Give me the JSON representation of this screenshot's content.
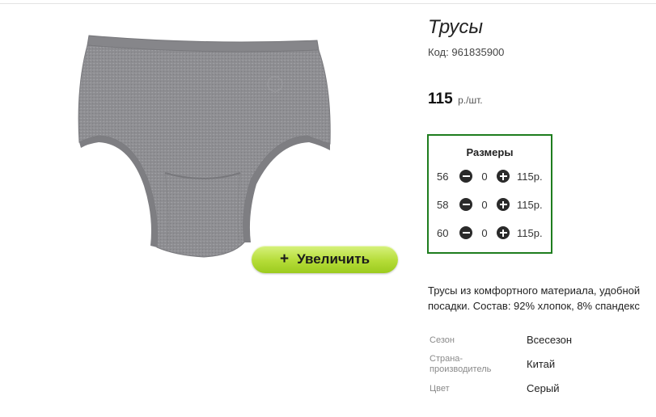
{
  "product": {
    "title": "Трусы",
    "code_label": "Код:",
    "code_value": "961835900",
    "price_value": "115",
    "price_unit": "р./шт.",
    "image_icon": "briefs-photo",
    "zoom_button": {
      "icon": "+",
      "label": "Увеличить"
    }
  },
  "sizes": {
    "title": "Размеры",
    "rows": [
      {
        "size": "56",
        "qty": "0",
        "price": "115р."
      },
      {
        "size": "58",
        "qty": "0",
        "price": "115р."
      },
      {
        "size": "60",
        "qty": "0",
        "price": "115р."
      }
    ],
    "minus_icon": "minus-circle-icon",
    "plus_icon": "plus-circle-icon",
    "border_color": "#1e7d1e"
  },
  "description": {
    "line1": "Трусы из комфортного материала, удобной",
    "line2": "посадки. Состав: 92% хлопок, 8% спандекс"
  },
  "attributes": [
    {
      "label_line1": "Сезон",
      "label_line2": "",
      "value": "Всесезон"
    },
    {
      "label_line1": "Страна-",
      "label_line2": "производитель",
      "value": "Китай"
    },
    {
      "label_line1": "Цвет",
      "label_line2": "",
      "value": "Серый"
    }
  ],
  "colors": {
    "zoom_button": "#b5dc38",
    "fabric": "#8e8e92"
  }
}
